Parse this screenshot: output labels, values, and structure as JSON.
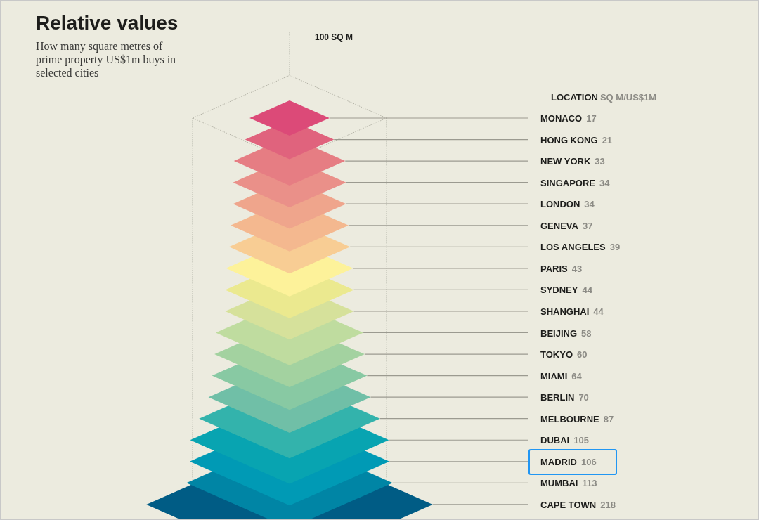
{
  "title": "Relative values",
  "subtitle": "How many square metres of prime property US$1m buys in selected cities",
  "reference_label": "100 SQ M",
  "legend": {
    "location": "LOCATION",
    "unit": "SQ M/US$1M"
  },
  "cities": [
    {
      "name": "MONACO",
      "value": "17",
      "color": "#dc4a78",
      "selected": false
    },
    {
      "name": "HONG KONG",
      "value": "21",
      "color": "#e0637d",
      "selected": false
    },
    {
      "name": "NEW YORK",
      "value": "33",
      "color": "#e67d83",
      "selected": false
    },
    {
      "name": "SINGAPORE",
      "value": "34",
      "color": "#ea9089",
      "selected": false
    },
    {
      "name": "LONDON",
      "value": "34",
      "color": "#efa58c",
      "selected": false
    },
    {
      "name": "GENEVA",
      "value": "37",
      "color": "#f4b88f",
      "selected": false
    },
    {
      "name": "LOS ANGELES",
      "value": "39",
      "color": "#f8cd94",
      "selected": false
    },
    {
      "name": "PARIS",
      "value": "43",
      "color": "#fdf29a",
      "selected": false
    },
    {
      "name": "SYDNEY",
      "value": "44",
      "color": "#ebe98f",
      "selected": false
    },
    {
      "name": "SHANGHAI",
      "value": "44",
      "color": "#d6e19b",
      "selected": false
    },
    {
      "name": "BEIJING",
      "value": "58",
      "color": "#bfdc9f",
      "selected": false
    },
    {
      "name": "TOKYO",
      "value": "60",
      "color": "#a3d2a0",
      "selected": false
    },
    {
      "name": "MIAMI",
      "value": "64",
      "color": "#88c9a3",
      "selected": false
    },
    {
      "name": "BERLIN",
      "value": "70",
      "color": "#70bfa7",
      "selected": false
    },
    {
      "name": "MELBOURNE",
      "value": "87",
      "color": "#33b3ac",
      "selected": false
    },
    {
      "name": "DUBAI",
      "value": "105",
      "color": "#08a4b1",
      "selected": false
    },
    {
      "name": "MADRID",
      "value": "106",
      "color": "#009ab5",
      "selected": true
    },
    {
      "name": "MUMBAI",
      "value": "113",
      "color": "#0085a5",
      "selected": false
    },
    {
      "name": "CAPE TOWN",
      "value": "218",
      "color": "#005c85",
      "selected": false
    }
  ]
}
